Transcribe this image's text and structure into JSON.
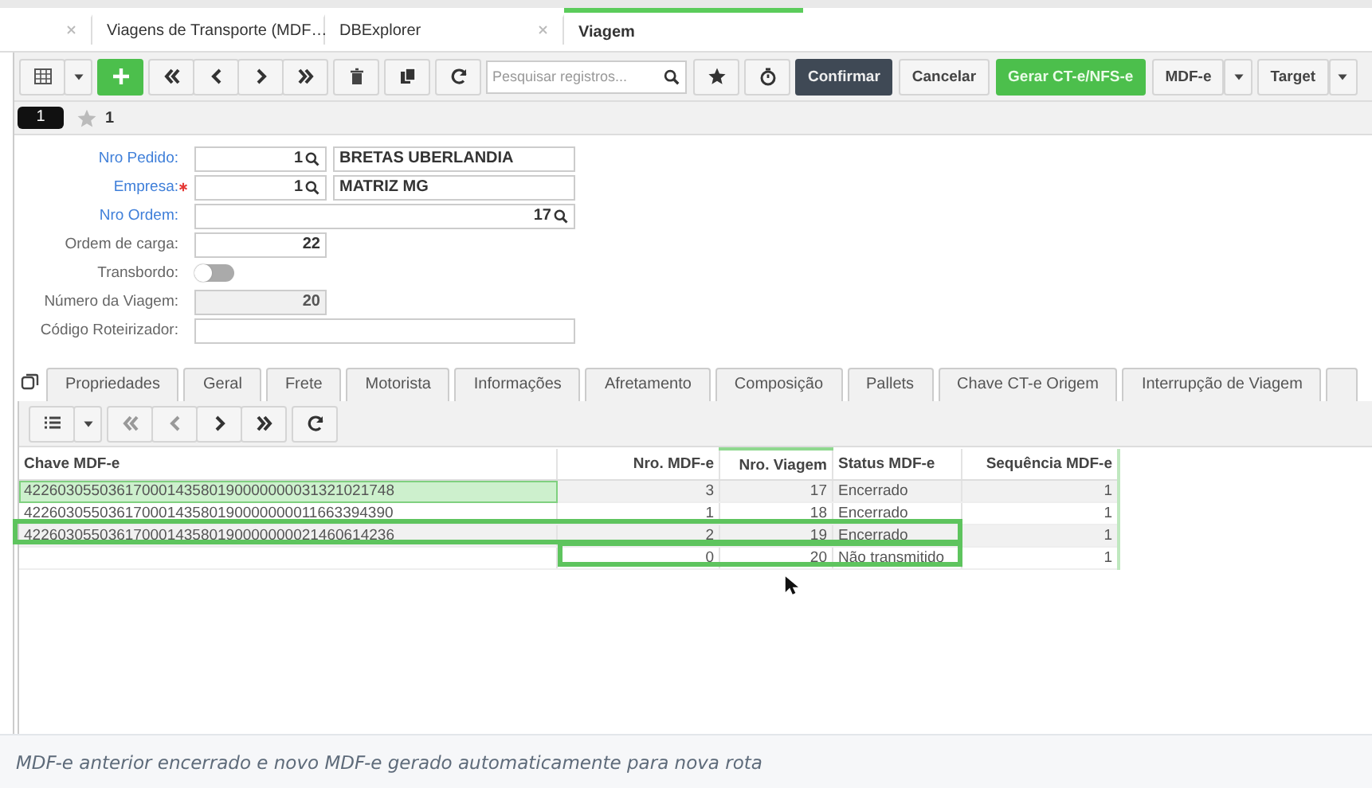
{
  "tabs": [
    {
      "label": "Viagens de Transporte (MDF…",
      "selected": false
    },
    {
      "label": "DBExplorer",
      "selected": false
    },
    {
      "label": "Viagem",
      "selected": true
    }
  ],
  "toolbar": {
    "search": {
      "placeholder": "Pesquisar registros..."
    },
    "buttons": [
      {
        "label": "Confirmar",
        "kind": "dark"
      },
      {
        "label": "Cancelar",
        "kind": "plain"
      },
      {
        "label": "Gerar CT-e/NFS-e",
        "kind": "green"
      },
      {
        "label": "MDF-e",
        "kind": "split"
      },
      {
        "label": "Target",
        "kind": "split"
      }
    ]
  },
  "record": {
    "number": "1",
    "favorites": "1"
  },
  "form": [
    {
      "label": "Nro Pedido:",
      "kind": "lookup",
      "link": true,
      "required": false,
      "value": "1",
      "description": "BRETAS UBERLANDIA"
    },
    {
      "label": "Empresa:",
      "kind": "lookup",
      "link": true,
      "required": true,
      "value": "1",
      "description": "MATRIZ MG"
    },
    {
      "label": "Nro Ordem:",
      "kind": "lookup-wide",
      "link": true,
      "required": false,
      "value": "17"
    },
    {
      "label": "Ordem de carga:",
      "kind": "number",
      "link": false,
      "required": false,
      "value": "22"
    },
    {
      "label": "Transbordo:",
      "kind": "toggle",
      "link": false,
      "required": false,
      "on": false
    },
    {
      "label": "Número da Viagem:",
      "kind": "number",
      "link": false,
      "required": false,
      "disabled": true,
      "value": "20"
    },
    {
      "label": "Código Roteirizador:",
      "kind": "text-wide",
      "link": false,
      "required": false
    }
  ],
  "subtabs": [
    {
      "label": "Propriedades",
      "selected": false
    },
    {
      "label": "Geral",
      "selected": false
    },
    {
      "label": "Frete",
      "selected": false
    },
    {
      "label": "Motorista",
      "selected": false
    },
    {
      "label": "Informações",
      "selected": false
    },
    {
      "label": "Afretamento",
      "selected": false
    },
    {
      "label": "Composição",
      "selected": false
    },
    {
      "label": "Pallets",
      "selected": false
    },
    {
      "label": "Chave CT-e Origem",
      "selected": false
    },
    {
      "label": "Interrupção de Viagem",
      "selected": false
    }
  ],
  "table": {
    "columns": [
      "Chave MDF-e",
      "Nro. MDF-e",
      "Nro. Viagem",
      "Status MDF-e",
      "Sequência MDF-e"
    ],
    "rows": [
      {
        "cells": [
          "42260305503617000143580190000000031321021748",
          "3",
          "17",
          "Encerrado",
          "1"
        ],
        "selected": true,
        "highlighted": false
      },
      {
        "cells": [
          "42260305503617000143580190000000011663394390",
          "1",
          "18",
          "Encerrado",
          "1"
        ],
        "selected": false,
        "highlighted": false
      },
      {
        "cells": [
          "42260305503617000143580190000000021460614236",
          "2",
          "19",
          "Encerrado",
          "1"
        ],
        "selected": false,
        "highlighted": true
      },
      {
        "cells": [
          "",
          "0",
          "20",
          "Não transmitido",
          "1"
        ],
        "selected": false,
        "highlighted": true
      }
    ]
  },
  "caption": "MDF-e anterior encerrado e novo MDF-e gerado automaticamente para nova rota"
}
